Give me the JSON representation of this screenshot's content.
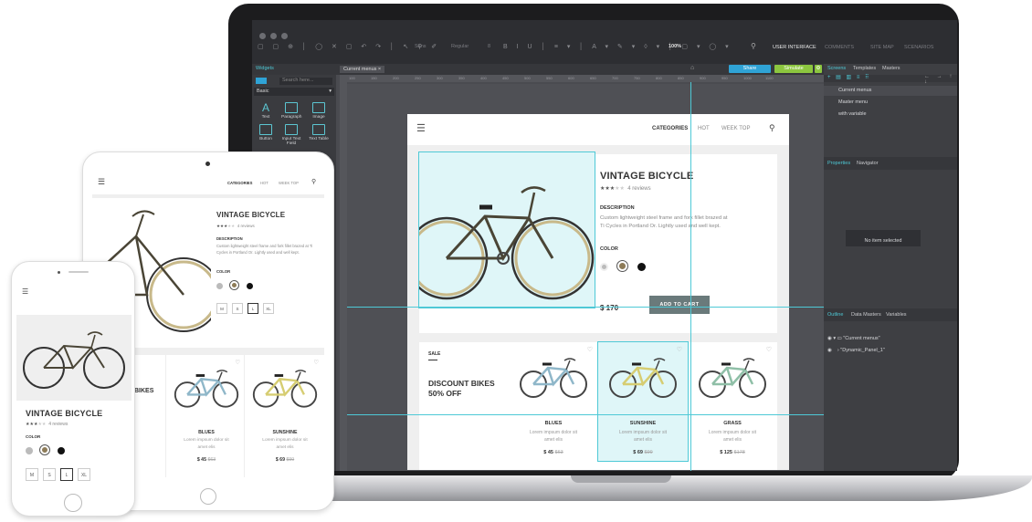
{
  "editor": {
    "top_right": {
      "user_interface": "USER INTERFACE",
      "comments": "COMMENTS",
      "site_map": "SITE MAP",
      "scenarios": "SCENARIOS",
      "zoom": "100%"
    },
    "font_controls": {
      "font": "Sans",
      "weight": "Regular",
      "size": "8"
    },
    "doc_tab": "Current menus",
    "share_label": "Share",
    "simulate_label": "Simulate",
    "left_panel": {
      "title": "Widgets",
      "search_placeholder": "Search here...",
      "category": "Basic",
      "widgets": [
        "Text",
        "Paragraph",
        "Image",
        "Button",
        "Input Text Field",
        "Text Table"
      ]
    },
    "ruler_ticks": [
      "100",
      "150",
      "200",
      "250",
      "300",
      "350",
      "400",
      "450",
      "500",
      "550",
      "600",
      "650",
      "700",
      "750",
      "800",
      "850",
      "900",
      "950",
      "1000",
      "1100"
    ],
    "right_panel": {
      "tabs": [
        "Screens",
        "Templates",
        "Masters"
      ],
      "screens": [
        "Current menus",
        "Master menu",
        "with variable"
      ],
      "props_tabs": [
        "Properties",
        "Navigator"
      ],
      "no_item": "No item selected",
      "outline_tabs": [
        "Outline",
        "Data Masters",
        "Variables"
      ],
      "outline_items": [
        "\"Current menus\"",
        "\"Dynamic_Panel_1\""
      ]
    },
    "colors": {
      "accent": "#2fa3d6",
      "simulate": "#8cc63f",
      "guide": "#4ec9d6"
    }
  },
  "site": {
    "nav": [
      "CATEGORIES",
      "HOT",
      "WEEK TOP"
    ],
    "product": {
      "title": "VINTAGE BICYCLE",
      "rating": 3,
      "reviews": "4 reviews",
      "description_label": "DESCRIPTION",
      "description": "Custom lightweight steel frame and fork fillet brazed at Ti Cycles in Portland Or. Lightly used and well kept.",
      "color_label": "COLOR",
      "price": "$ 170",
      "add_to_cart": "ADD TO CART",
      "sizes": [
        "M",
        "S",
        "L",
        "XL"
      ]
    },
    "promo": {
      "tag": "SALE",
      "title": "DISCOUNT BIKES 50% OFF",
      "title_short": "BIKES"
    },
    "products": [
      {
        "name": "BLUES",
        "desc": "Lorem impsum dolor sit amet elis",
        "price": "$ 45",
        "old": "$63",
        "color": "#8fb7c9"
      },
      {
        "name": "SUNSHINE",
        "desc": "Lorem impsum dolor sit amet elis",
        "price": "$ 69",
        "old": "$99",
        "color": "#d6cd72"
      },
      {
        "name": "GRASS",
        "desc": "Lorem impsum dolor sit amet elis",
        "price": "$ 125",
        "old": "$178",
        "color": "#8fbfa7"
      }
    ]
  }
}
